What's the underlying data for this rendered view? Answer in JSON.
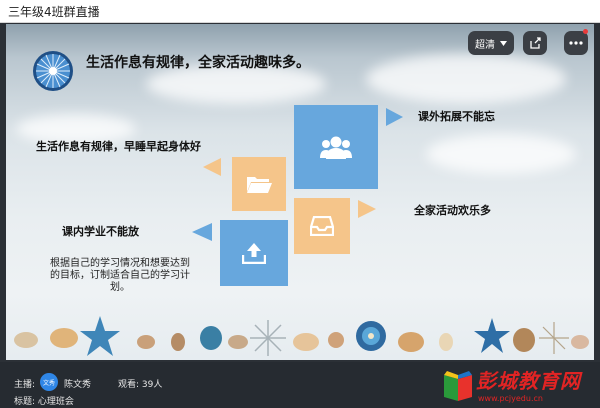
{
  "window": {
    "title": "三年级4班群直播"
  },
  "controls": {
    "quality_label": "超清"
  },
  "slide": {
    "headline": "生活作息有规律，全家活动趣味多。",
    "items": [
      {
        "label": "课外拓展不能忘"
      },
      {
        "label": "生活作息有规律，早睡早起身体好"
      },
      {
        "label": "全家活动欢乐多"
      },
      {
        "label": "课内学业不能放"
      }
    ],
    "paragraph": "根据自己的学习情况和想要达到的目标，订制适合自己的学习计划。"
  },
  "info": {
    "host_label": "主播:",
    "avatar_text": "文秀",
    "host_name": "陈文秀",
    "viewers_label": "观看: 39人",
    "topic_label": "标题: 心理班会"
  },
  "logo": {
    "text": "彭城教育网",
    "url": "www.pcjyedu.cn"
  },
  "colors": {
    "tile_blue": "#67a7dd",
    "tile_orange": "#f5c58a",
    "logo_red": "#e12424"
  }
}
